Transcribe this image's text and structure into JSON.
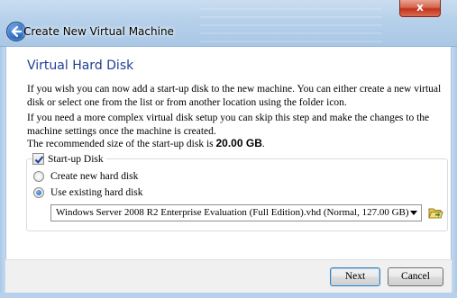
{
  "window": {
    "title": "Create New Virtual Machine",
    "close_glyph": "x"
  },
  "page": {
    "heading": "Virtual Hard Disk",
    "paragraph1": "If you wish you can now add a start-up disk to the new machine. You can either create a new virtual disk or select one from the list or from another location using the folder icon.",
    "paragraph2": "If you need a more complex virtual disk setup you can skip this step and make the changes to the machine settings once the machine is created.",
    "recommended_prefix": "The recommended size of the start-up disk is ",
    "recommended_size": "20.00 GB",
    "recommended_suffix": "."
  },
  "startup_disk": {
    "checkbox_label": "Start-up Disk",
    "checked": true,
    "options": [
      {
        "label": "Create new hard disk",
        "selected": false
      },
      {
        "label": "Use existing hard disk",
        "selected": true
      }
    ],
    "selected_disk": "Windows Server 2008 R2 Enterprise Evaluation (Full Edition).vhd (Normal, 127.00 GB)"
  },
  "buttons": {
    "next": "Next",
    "cancel": "Cancel"
  },
  "icons": {
    "back": "back-arrow-icon",
    "close": "close-icon",
    "dropdown": "chevron-down-icon",
    "folder": "folder-icon"
  }
}
